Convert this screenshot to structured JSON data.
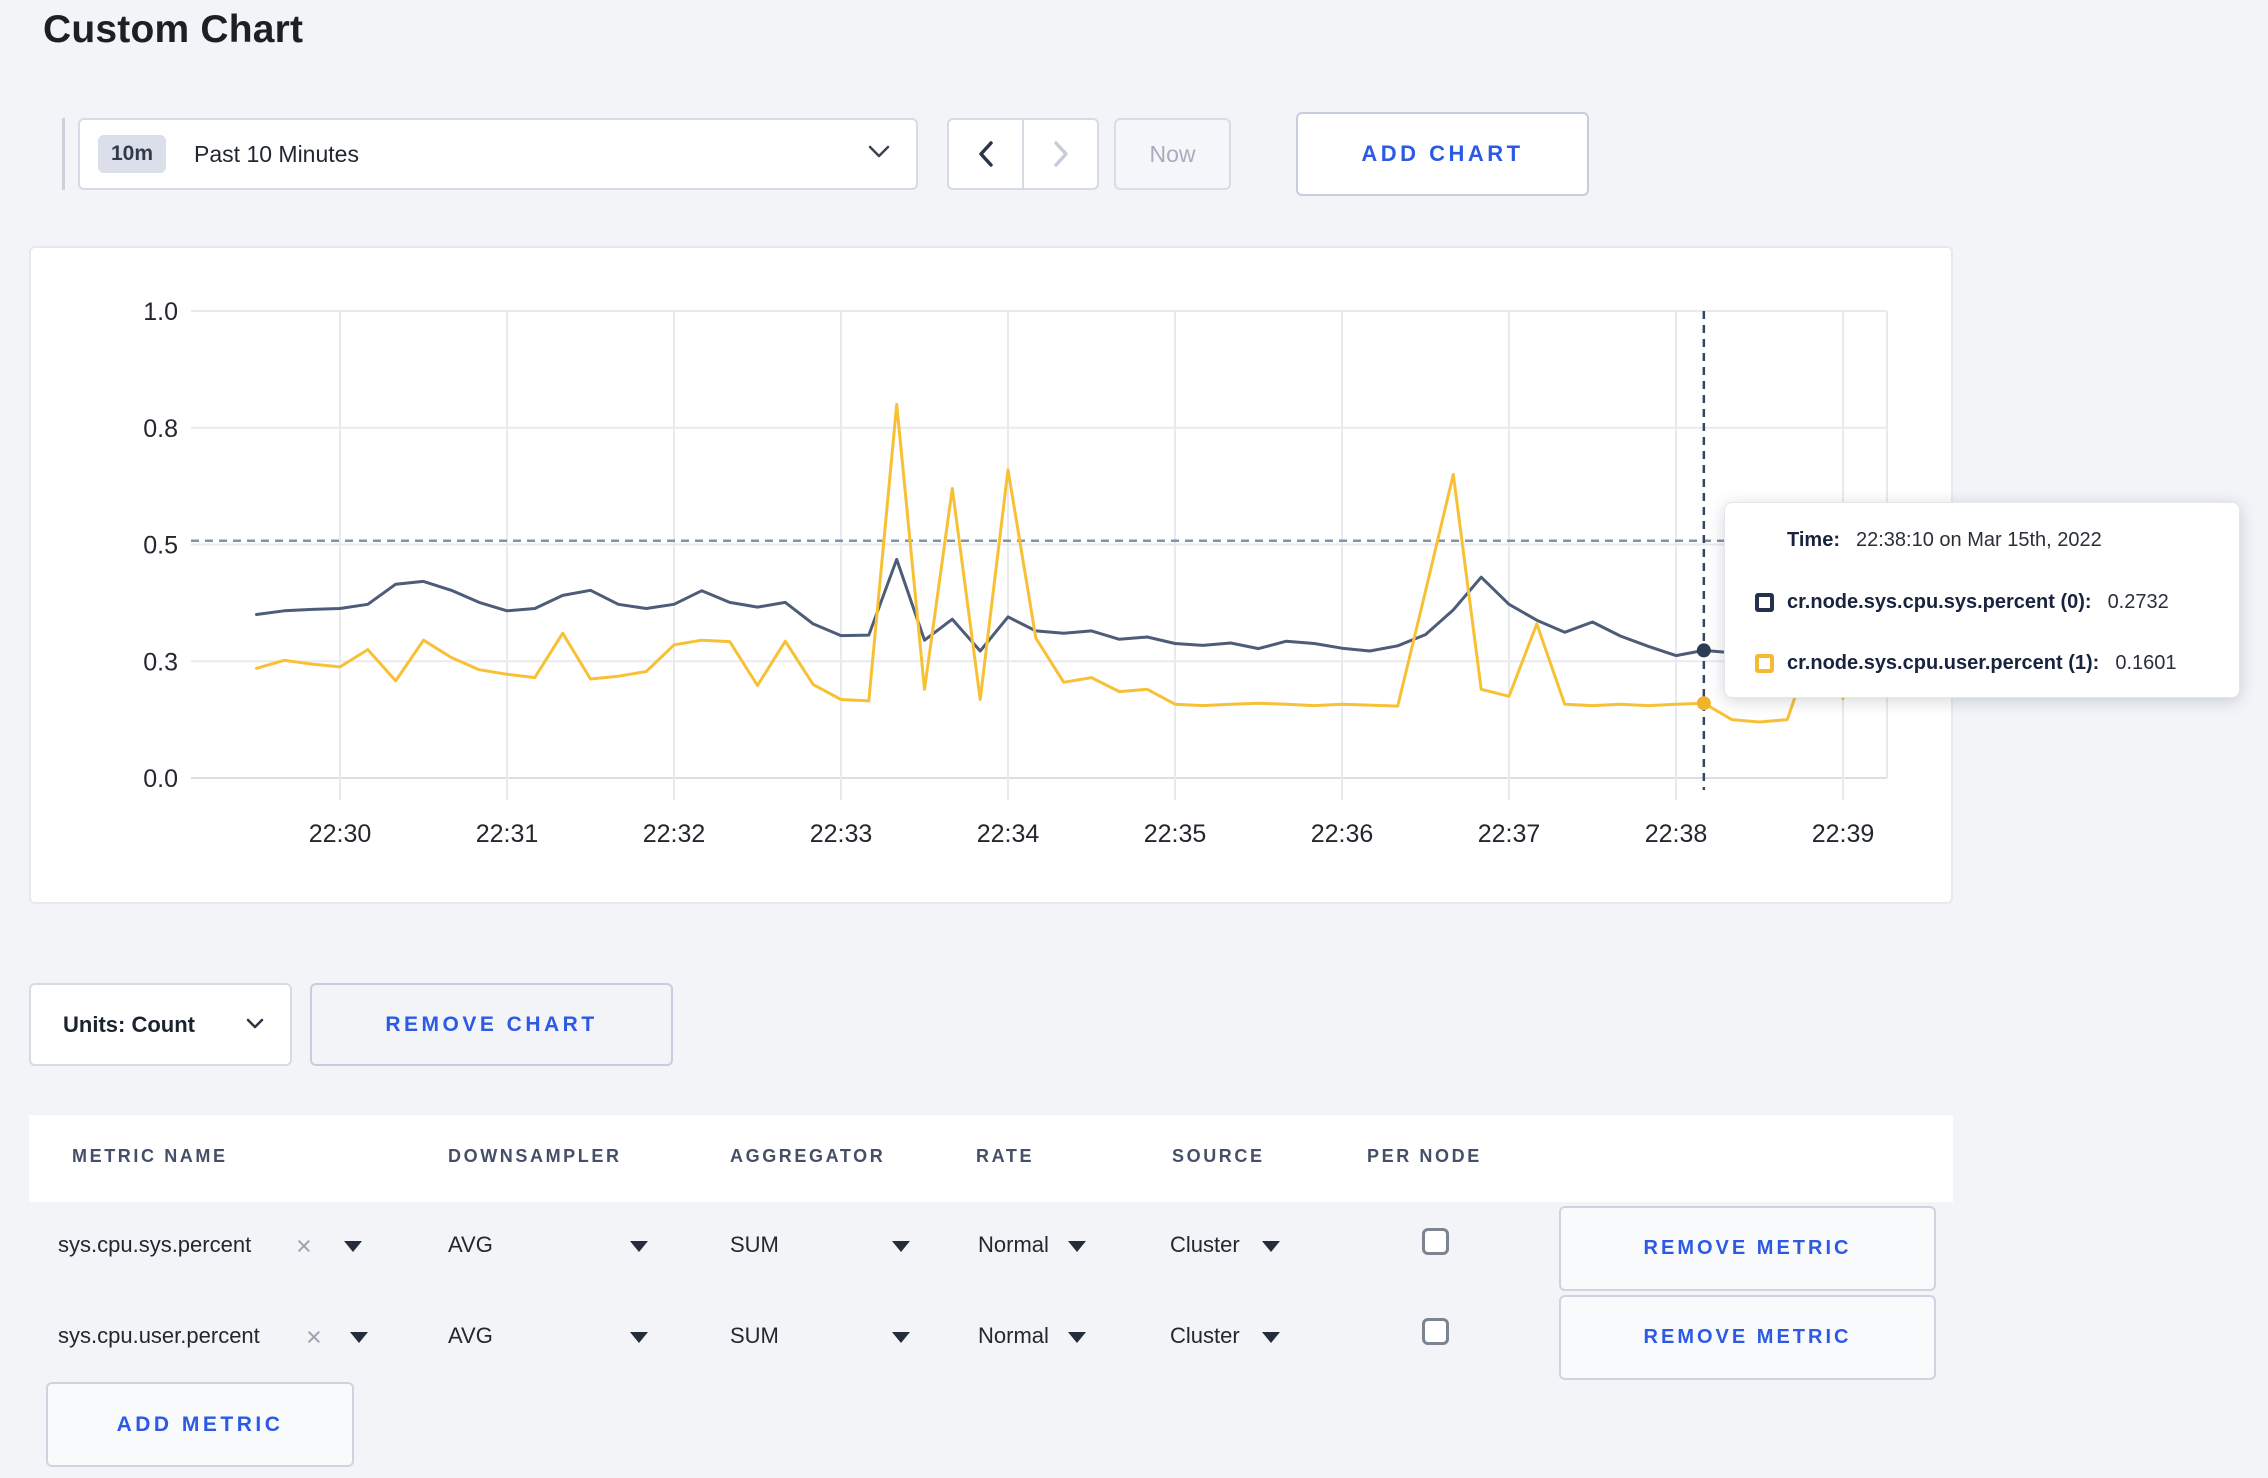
{
  "page": {
    "title": "Custom Chart"
  },
  "toolbar": {
    "range_badge": "10m",
    "range_label": "Past 10 Minutes",
    "now_label": "Now",
    "add_chart_label": "ADD CHART"
  },
  "chart_controls": {
    "units_label": "Units: Count",
    "remove_chart_label": "REMOVE CHART"
  },
  "chart_data": {
    "type": "line",
    "title": "",
    "xlabel": "",
    "ylabel": "",
    "grid": true,
    "legend_position": "tooltip",
    "ylim": [
      0,
      1.0
    ],
    "y_ticks": [
      "1.0",
      "0.8",
      "0.5",
      "0.3",
      "0.0"
    ],
    "y_tick_values": [
      1.0,
      0.75,
      0.5,
      0.25,
      0.0
    ],
    "x_ticks": [
      "22:30",
      "22:31",
      "22:32",
      "22:33",
      "22:34",
      "22:35",
      "22:36",
      "22:37",
      "22:38",
      "22:39"
    ],
    "x_start": "22:29:30",
    "x_step_seconds": 10,
    "threshold_value": 0.508,
    "crosshair": {
      "time": "22:38:10",
      "minutes_after_2230": 8.1667,
      "sys_value": 0.2732,
      "user_value": 0.1601
    },
    "series": [
      {
        "name": "cr.node.sys.cpu.sys.percent",
        "color": "#4d5c78",
        "values": [
          0.35,
          0.358,
          0.361,
          0.363,
          0.372,
          0.415,
          0.421,
          0.402,
          0.376,
          0.358,
          0.363,
          0.391,
          0.402,
          0.372,
          0.363,
          0.372,
          0.401,
          0.376,
          0.366,
          0.376,
          0.33,
          0.305,
          0.306,
          0.468,
          0.295,
          0.34,
          0.272,
          0.345,
          0.315,
          0.31,
          0.315,
          0.297,
          0.302,
          0.288,
          0.284,
          0.289,
          0.277,
          0.293,
          0.288,
          0.278,
          0.272,
          0.283,
          0.307,
          0.36,
          0.43,
          0.372,
          0.338,
          0.312,
          0.334,
          0.304,
          0.282,
          0.262,
          0.2732,
          0.268,
          0.282,
          0.298,
          0.31,
          0.3
        ]
      },
      {
        "name": "cr.node.sys.cpu.user.percent",
        "color": "#f8c135",
        "values": [
          0.235,
          0.252,
          0.244,
          0.238,
          0.275,
          0.208,
          0.295,
          0.258,
          0.232,
          0.222,
          0.215,
          0.31,
          0.212,
          0.218,
          0.228,
          0.285,
          0.295,
          0.292,
          0.198,
          0.293,
          0.2,
          0.168,
          0.165,
          0.8,
          0.19,
          0.62,
          0.168,
          0.66,
          0.3,
          0.205,
          0.215,
          0.185,
          0.19,
          0.158,
          0.155,
          0.158,
          0.16,
          0.158,
          0.155,
          0.158,
          0.156,
          0.154,
          0.4,
          0.65,
          0.19,
          0.175,
          0.33,
          0.158,
          0.155,
          0.158,
          0.155,
          0.158,
          0.1601,
          0.125,
          0.12,
          0.125,
          0.3,
          0.17
        ]
      }
    ]
  },
  "tooltip": {
    "time_label": "Time:",
    "time_value": "22:38:10 on Mar 15th, 2022",
    "rows": [
      {
        "label": "cr.node.sys.cpu.sys.percent (0):",
        "value": "0.2732",
        "color": "#24304e"
      },
      {
        "label": "cr.node.sys.cpu.user.percent (1):",
        "value": "0.1601",
        "color": "#f2bb30"
      }
    ]
  },
  "metrics_table": {
    "headers": {
      "metric_name": "METRIC NAME",
      "downsampler": "DOWNSAMPLER",
      "aggregator": "AGGREGATOR",
      "rate": "RATE",
      "source": "SOURCE",
      "per_node": "PER NODE"
    },
    "rows": [
      {
        "metric": "sys.cpu.sys.percent",
        "downsampler": "AVG",
        "aggregator": "SUM",
        "rate": "Normal",
        "source": "Cluster",
        "per_node_checked": false,
        "remove_label": "REMOVE METRIC"
      },
      {
        "metric": "sys.cpu.user.percent",
        "downsampler": "AVG",
        "aggregator": "SUM",
        "rate": "Normal",
        "source": "Cluster",
        "per_node_checked": false,
        "remove_label": "REMOVE METRIC"
      }
    ],
    "add_metric_label": "ADD METRIC"
  },
  "colors": {
    "accent_blue": "#2c5ae5",
    "series_sys": "#4d5c78",
    "series_user": "#f8c135",
    "page_bg": "#f2f4f8"
  }
}
